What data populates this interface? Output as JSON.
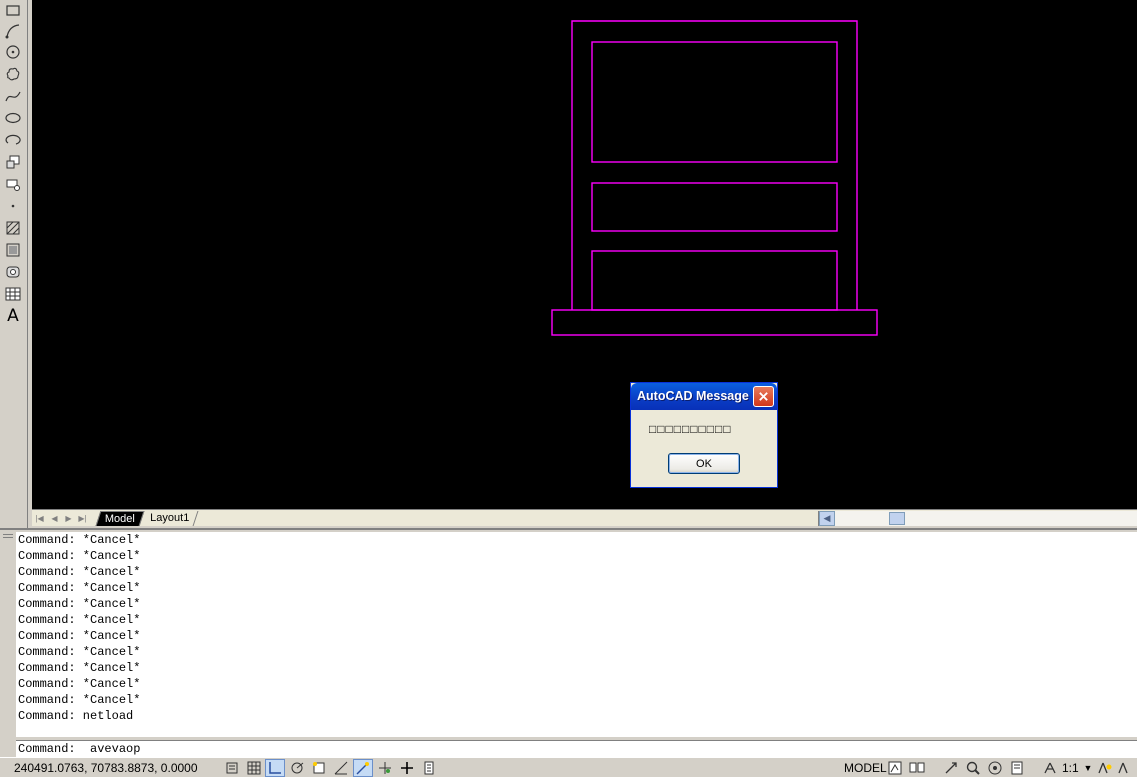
{
  "drawing": {
    "stroke_color": "#ff00ff",
    "background": "#000000"
  },
  "left_toolbar": {
    "tools": [
      "rectangle-icon",
      "arc-icon",
      "circle-icon",
      "revision-cloud-icon",
      "spline-icon",
      "ellipse-icon",
      "ellipse-arc-icon",
      "insert-block-icon",
      "make-block-icon",
      "point-icon",
      "hatch-icon",
      "gradient-icon",
      "region-icon",
      "table-icon",
      "multiline-text-icon"
    ],
    "text_tool_glyph": "A"
  },
  "tabs": {
    "model": "Model",
    "layout1": "Layout1"
  },
  "command_window": {
    "history": [
      "Command: *Cancel*",
      "Command: *Cancel*",
      "Command: *Cancel*",
      "Command: *Cancel*",
      "Command: *Cancel*",
      "Command: *Cancel*",
      "Command: *Cancel*",
      "Command: *Cancel*",
      "Command: *Cancel*",
      "Command: *Cancel*",
      "Command: *Cancel*",
      "Command: netload"
    ],
    "current_prompt": "Command:  avevaop"
  },
  "status_bar": {
    "coordinates": "240491.0763, 70783.8873, 0.0000",
    "model_label": "MODEL",
    "annotation_scale": "1:1"
  },
  "dialog": {
    "title": "AutoCAD Message",
    "message": "□□□□□□□□□□",
    "ok_label": "OK",
    "accent": "#0a5fe0"
  }
}
